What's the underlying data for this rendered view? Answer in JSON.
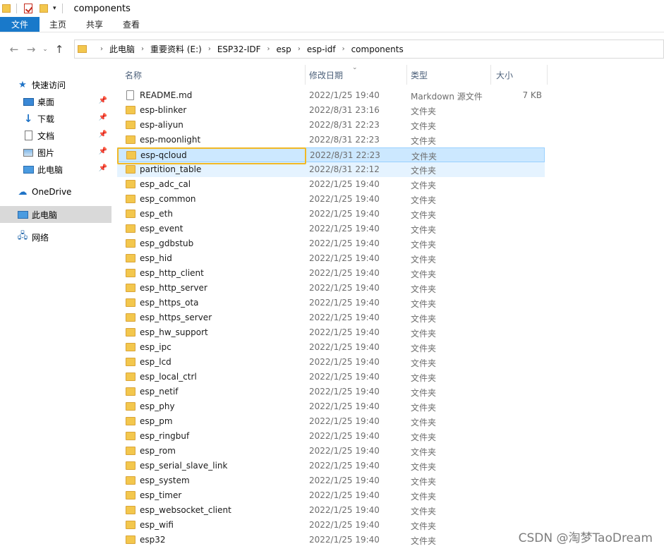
{
  "window": {
    "title": "components",
    "quick_access_icons": [
      "folder-icon",
      "properties-check-icon",
      "new-folder-icon",
      "customize-dropdown-icon"
    ]
  },
  "ribbon": {
    "tabs": [
      "文件",
      "主页",
      "共享",
      "查看"
    ]
  },
  "navigation": {
    "back_icon": "←",
    "forward_icon": "→",
    "recent_icon": "⌄",
    "up_icon": "↑"
  },
  "breadcrumb": [
    "此电脑",
    "重要资料 (E:)",
    "ESP32-IDF",
    "esp",
    "esp-idf",
    "components"
  ],
  "sidebar": {
    "items": [
      {
        "label": "快速访问",
        "icon": "star-icon",
        "pinned": false
      },
      {
        "label": "桌面",
        "icon": "desktop-icon",
        "pinned": true
      },
      {
        "label": "下载",
        "icon": "download-icon",
        "pinned": true
      },
      {
        "label": "文档",
        "icon": "document-icon",
        "pinned": true
      },
      {
        "label": "图片",
        "icon": "pictures-icon",
        "pinned": true
      },
      {
        "label": "此电脑",
        "icon": "computer-icon",
        "pinned": true
      },
      {
        "label": "OneDrive",
        "icon": "cloud-icon",
        "pinned": false
      },
      {
        "label": "此电脑",
        "icon": "computer-icon",
        "pinned": false,
        "selected": true
      },
      {
        "label": "网络",
        "icon": "network-icon",
        "pinned": false
      }
    ]
  },
  "columns": {
    "name": "名称",
    "date": "修改日期",
    "type": "类型",
    "size": "大小"
  },
  "files": [
    {
      "name": "README.md",
      "date": "2022/1/25 19:40",
      "type": "Markdown 源文件",
      "size": "7 KB",
      "kind": "file"
    },
    {
      "name": "esp-blinker",
      "date": "2022/8/31 23:16",
      "type": "文件夹",
      "size": "",
      "kind": "folder"
    },
    {
      "name": "esp-aliyun",
      "date": "2022/8/31 22:23",
      "type": "文件夹",
      "size": "",
      "kind": "folder"
    },
    {
      "name": "esp-moonlight",
      "date": "2022/8/31 22:23",
      "type": "文件夹",
      "size": "",
      "kind": "folder"
    },
    {
      "name": "esp-qcloud",
      "date": "2022/8/31 22:23",
      "type": "文件夹",
      "size": "",
      "kind": "folder",
      "state": "selected"
    },
    {
      "name": "partition_table",
      "date": "2022/8/31 22:12",
      "type": "文件夹",
      "size": "",
      "kind": "folder",
      "state": "hover"
    },
    {
      "name": "esp_adc_cal",
      "date": "2022/1/25 19:40",
      "type": "文件夹",
      "size": "",
      "kind": "folder"
    },
    {
      "name": "esp_common",
      "date": "2022/1/25 19:40",
      "type": "文件夹",
      "size": "",
      "kind": "folder"
    },
    {
      "name": "esp_eth",
      "date": "2022/1/25 19:40",
      "type": "文件夹",
      "size": "",
      "kind": "folder"
    },
    {
      "name": "esp_event",
      "date": "2022/1/25 19:40",
      "type": "文件夹",
      "size": "",
      "kind": "folder"
    },
    {
      "name": "esp_gdbstub",
      "date": "2022/1/25 19:40",
      "type": "文件夹",
      "size": "",
      "kind": "folder"
    },
    {
      "name": "esp_hid",
      "date": "2022/1/25 19:40",
      "type": "文件夹",
      "size": "",
      "kind": "folder"
    },
    {
      "name": "esp_http_client",
      "date": "2022/1/25 19:40",
      "type": "文件夹",
      "size": "",
      "kind": "folder"
    },
    {
      "name": "esp_http_server",
      "date": "2022/1/25 19:40",
      "type": "文件夹",
      "size": "",
      "kind": "folder"
    },
    {
      "name": "esp_https_ota",
      "date": "2022/1/25 19:40",
      "type": "文件夹",
      "size": "",
      "kind": "folder"
    },
    {
      "name": "esp_https_server",
      "date": "2022/1/25 19:40",
      "type": "文件夹",
      "size": "",
      "kind": "folder"
    },
    {
      "name": "esp_hw_support",
      "date": "2022/1/25 19:40",
      "type": "文件夹",
      "size": "",
      "kind": "folder"
    },
    {
      "name": "esp_ipc",
      "date": "2022/1/25 19:40",
      "type": "文件夹",
      "size": "",
      "kind": "folder"
    },
    {
      "name": "esp_lcd",
      "date": "2022/1/25 19:40",
      "type": "文件夹",
      "size": "",
      "kind": "folder"
    },
    {
      "name": "esp_local_ctrl",
      "date": "2022/1/25 19:40",
      "type": "文件夹",
      "size": "",
      "kind": "folder"
    },
    {
      "name": "esp_netif",
      "date": "2022/1/25 19:40",
      "type": "文件夹",
      "size": "",
      "kind": "folder"
    },
    {
      "name": "esp_phy",
      "date": "2022/1/25 19:40",
      "type": "文件夹",
      "size": "",
      "kind": "folder"
    },
    {
      "name": "esp_pm",
      "date": "2022/1/25 19:40",
      "type": "文件夹",
      "size": "",
      "kind": "folder"
    },
    {
      "name": "esp_ringbuf",
      "date": "2022/1/25 19:40",
      "type": "文件夹",
      "size": "",
      "kind": "folder"
    },
    {
      "name": "esp_rom",
      "date": "2022/1/25 19:40",
      "type": "文件夹",
      "size": "",
      "kind": "folder"
    },
    {
      "name": "esp_serial_slave_link",
      "date": "2022/1/25 19:40",
      "type": "文件夹",
      "size": "",
      "kind": "folder"
    },
    {
      "name": "esp_system",
      "date": "2022/1/25 19:40",
      "type": "文件夹",
      "size": "",
      "kind": "folder"
    },
    {
      "name": "esp_timer",
      "date": "2022/1/25 19:40",
      "type": "文件夹",
      "size": "",
      "kind": "folder"
    },
    {
      "name": "esp_websocket_client",
      "date": "2022/1/25 19:40",
      "type": "文件夹",
      "size": "",
      "kind": "folder"
    },
    {
      "name": "esp_wifi",
      "date": "2022/1/25 19:40",
      "type": "文件夹",
      "size": "",
      "kind": "folder"
    },
    {
      "name": "esp32",
      "date": "2022/1/25 19:40",
      "type": "文件夹",
      "size": "",
      "kind": "folder"
    }
  ],
  "watermark": "CSDN @淘梦TaoDream",
  "colors": {
    "file_tab": "#1979ca",
    "selection": "#cce8ff",
    "hover": "#e5f3ff",
    "annotation_box": "#f1b824",
    "folder": "#f3c74d"
  }
}
